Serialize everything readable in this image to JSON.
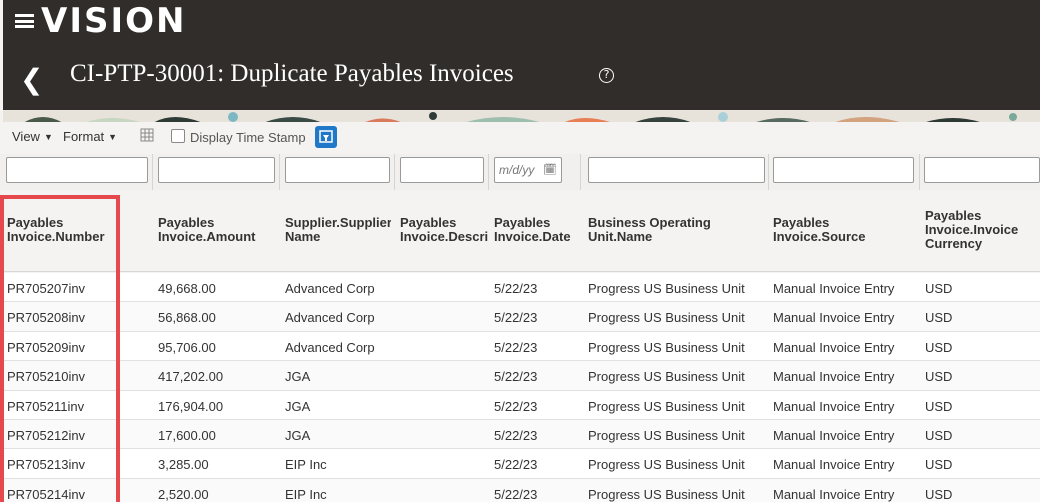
{
  "brand": "VISION",
  "page_title": "CI-PTP-30001: Duplicate Payables Invoices",
  "toolbar": {
    "view_label": "View",
    "format_label": "Format",
    "display_timestamp_label": "Display Time Stamp",
    "display_timestamp_checked": false
  },
  "filters": {
    "date_placeholder": "m/d/yy"
  },
  "columns": [
    "Payables\nInvoice.Number",
    "Payables\nInvoice.Amount",
    "Supplier.Supplier\nName",
    "Payables\nInvoice.Descrip",
    "Payables\nInvoice.Date",
    "Business Operating\nUnit.Name",
    "Payables\nInvoice.Source",
    "Payables\nInvoice.Invoice\nCurrency"
  ],
  "rows": [
    [
      "PR705207inv",
      "49,668.00",
      "Advanced Corp",
      "",
      "5/22/23",
      "Progress US Business Unit",
      "Manual Invoice Entry",
      "USD"
    ],
    [
      "PR705208inv",
      "56,868.00",
      "Advanced Corp",
      "",
      "5/22/23",
      "Progress US Business Unit",
      "Manual Invoice Entry",
      "USD"
    ],
    [
      "PR705209inv",
      "95,706.00",
      "Advanced Corp",
      "",
      "5/22/23",
      "Progress US Business Unit",
      "Manual Invoice Entry",
      "USD"
    ],
    [
      "PR705210inv",
      "417,202.00",
      "JGA",
      "",
      "5/22/23",
      "Progress US Business Unit",
      "Manual Invoice Entry",
      "USD"
    ],
    [
      "PR705211inv",
      "176,904.00",
      "JGA",
      "",
      "5/22/23",
      "Progress US Business Unit",
      "Manual Invoice Entry",
      "USD"
    ],
    [
      "PR705212inv",
      "17,600.00",
      "JGA",
      "",
      "5/22/23",
      "Progress US Business Unit",
      "Manual Invoice Entry",
      "USD"
    ],
    [
      "PR705213inv",
      "3,285.00",
      "EIP Inc",
      "",
      "5/22/23",
      "Progress US Business Unit",
      "Manual Invoice Entry",
      "USD"
    ],
    [
      "PR705214inv",
      "2,520.00",
      "EIP Inc",
      "",
      "5/22/23",
      "Progress US Business Unit",
      "Manual Invoice Entry",
      "USD"
    ]
  ],
  "colors": {
    "topbar": "#312d2a",
    "accent": "#1f78c8",
    "highlight": "#e5484d"
  }
}
